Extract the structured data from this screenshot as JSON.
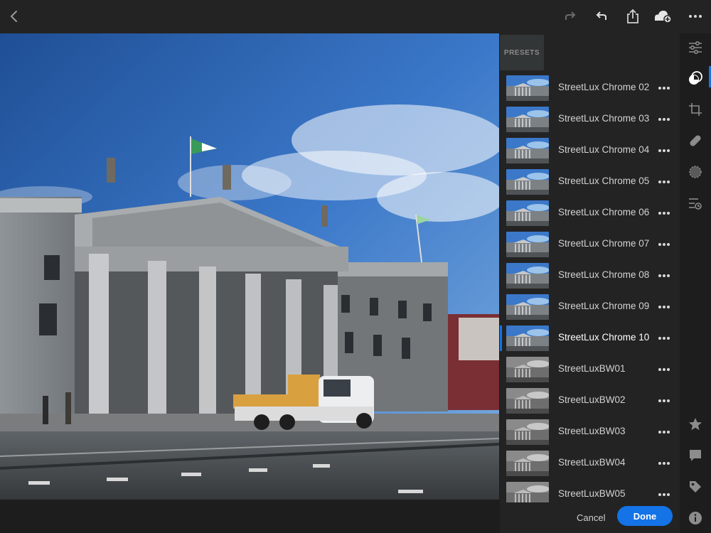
{
  "panel": {
    "tab_label": "PRESETS",
    "cancel_label": "Cancel",
    "done_label": "Done"
  },
  "presets": [
    {
      "name": "StreetLux Chrome 02",
      "style": "color"
    },
    {
      "name": "StreetLux Chrome 03",
      "style": "color"
    },
    {
      "name": "StreetLux Chrome 04",
      "style": "color"
    },
    {
      "name": "StreetLux Chrome 05",
      "style": "color"
    },
    {
      "name": "StreetLux Chrome 06",
      "style": "color"
    },
    {
      "name": "StreetLux Chrome 07",
      "style": "color"
    },
    {
      "name": "StreetLux Chrome 08",
      "style": "color"
    },
    {
      "name": "StreetLux Chrome 09",
      "style": "color"
    },
    {
      "name": "StreetLux Chrome 10",
      "style": "color",
      "selected": true
    },
    {
      "name": "StreetLuxBW01",
      "style": "bw"
    },
    {
      "name": "StreetLuxBW02",
      "style": "bw"
    },
    {
      "name": "StreetLuxBW03",
      "style": "bw"
    },
    {
      "name": "StreetLuxBW04",
      "style": "bw"
    },
    {
      "name": "StreetLuxBW05",
      "style": "bw"
    }
  ],
  "topbar_icons": [
    "back-icon",
    "redo-icon",
    "undo-icon",
    "share-icon",
    "cloud-add-icon",
    "more-icon"
  ],
  "tool_icons": [
    "edit-sliders-icon",
    "presets-icon",
    "crop-icon",
    "healing-icon",
    "selective-icon",
    "versions-icon",
    "rating-star-icon",
    "comment-icon",
    "tag-icon",
    "info-icon"
  ],
  "colors": {
    "accent": "#1473e6",
    "panel_bg": "#232323",
    "app_bg": "#1d1d1d"
  }
}
